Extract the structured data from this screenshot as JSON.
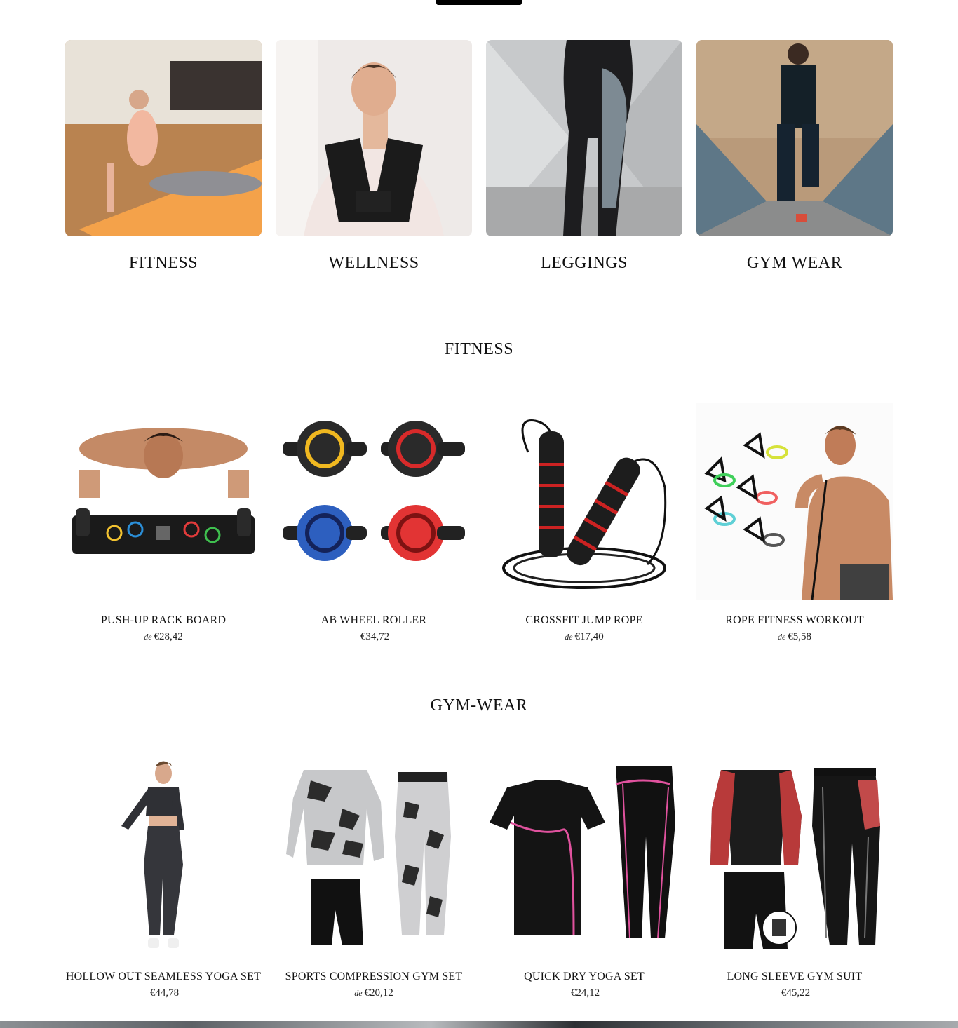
{
  "collections": [
    {
      "label": "FITNESS"
    },
    {
      "label": "WELLNESS"
    },
    {
      "label": "LEGGINGS"
    },
    {
      "label": "GYM WEAR"
    }
  ],
  "sections": {
    "fitness": {
      "title": "FITNESS",
      "products": [
        {
          "name": "PUSH-UP RACK BOARD",
          "from": "de",
          "price": "€28,42"
        },
        {
          "name": "AB WHEEL ROLLER",
          "from": "",
          "price": "€34,72"
        },
        {
          "name": "CROSSFIT JUMP ROPE",
          "from": "de",
          "price": "€17,40"
        },
        {
          "name": "ROPE FITNESS WORKOUT",
          "from": "de",
          "price": "€5,58"
        }
      ]
    },
    "gymwear": {
      "title": "GYM-WEAR",
      "products": [
        {
          "name": "HOLLOW OUT SEAMLESS YOGA SET",
          "from": "",
          "price": "€44,78"
        },
        {
          "name": "SPORTS COMPRESSION GYM SET",
          "from": "de",
          "price": "€20,12"
        },
        {
          "name": "QUICK DRY YOGA SET",
          "from": "",
          "price": "€24,12"
        },
        {
          "name": "LONG SLEEVE GYM SUIT",
          "from": "",
          "price": "€45,22"
        }
      ]
    }
  }
}
